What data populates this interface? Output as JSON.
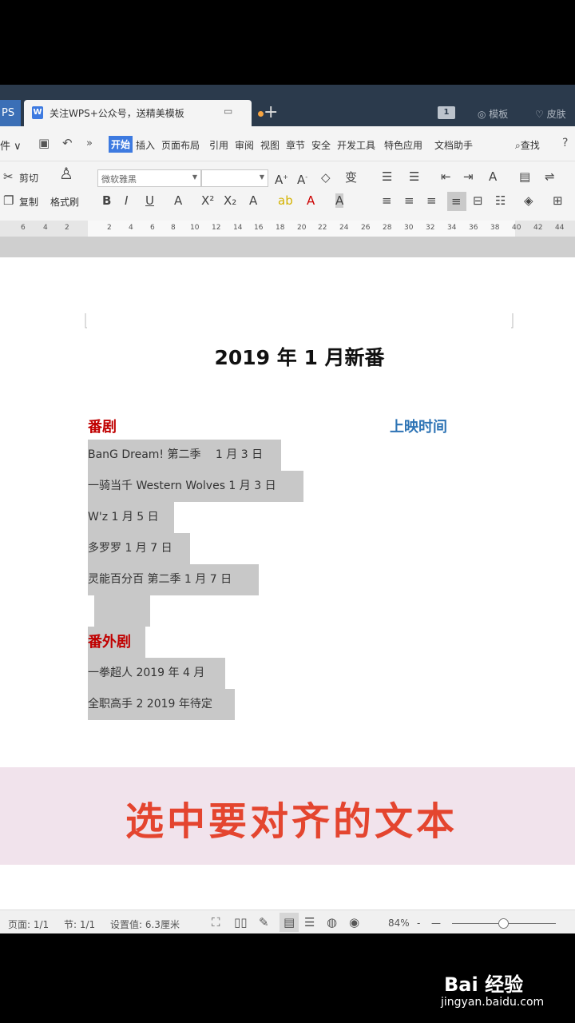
{
  "tabs": {
    "app_label": "PS",
    "doc_label": "关注WPS+公众号，送精美模板",
    "new_tab": "+",
    "right_num": "1",
    "templates": "模板",
    "skin": "皮肤"
  },
  "menu": {
    "file": "件 ∨",
    "items": [
      "开始",
      "插入",
      "页面布局",
      "引用",
      "审阅",
      "视图",
      "章节",
      "安全",
      "开发工具",
      "特色应用",
      "文档助手"
    ],
    "search": "查找"
  },
  "ribbon": {
    "cut": "剪切",
    "copy": "复制",
    "format_painter": "格式刷",
    "font_name": "微软雅黑"
  },
  "ruler": [
    "6",
    "4",
    "2",
    "",
    "2",
    "4",
    "6",
    "8",
    "10",
    "12",
    "14",
    "16",
    "18",
    "20",
    "22",
    "24",
    "26",
    "28",
    "30",
    "32",
    "34",
    "36",
    "38",
    "40",
    "42",
    "44"
  ],
  "document": {
    "title": "2019 年 1 月新番",
    "section1": "番剧",
    "column2": "上映时间",
    "lines1": [
      "BanG Dream! 第二季　 1 月 3 日",
      "一骑当千  Western Wolves   1 月 3 日",
      "W'z   1 月 5 日",
      "多罗罗   1 月 7 日",
      "灵能百分百  第二季    1 月 7 日",
      ""
    ],
    "section2": "番外剧",
    "lines2": [
      "一拳超人   2019 年 4 月",
      "全职高手 2   2019 年待定"
    ]
  },
  "banner": "选中要对齐的文本",
  "status": {
    "page": "页面: 1/1",
    "section": "节: 1/1",
    "setting": "设置值: 6.3厘米",
    "zoom": "84%",
    "zoom_minus": "-",
    "zoom_minus2": "—"
  },
  "watermark": {
    "logo": "Bai 经验",
    "url": "jingyan.baidu.com"
  }
}
